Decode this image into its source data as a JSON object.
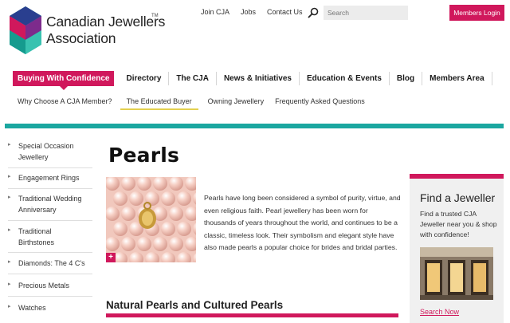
{
  "brand": {
    "line1": "Canadian Jewellers",
    "line2": "Association",
    "tm": "TM"
  },
  "utility": {
    "links": [
      "Join CJA",
      "Jobs",
      "Contact Us"
    ],
    "search_placeholder": "Search",
    "members_login": "Members Login"
  },
  "mainnav": {
    "items": [
      "Buying With Confidence",
      "Directory",
      "The CJA",
      "News & Initiatives",
      "Education & Events",
      "Blog",
      "Members Area"
    ],
    "active_index": 0
  },
  "subnav": {
    "items": [
      "Why Choose A CJA Member?",
      "The Educated Buyer",
      "Owning Jewellery",
      "Frequently Asked Questions"
    ],
    "active_index": 1
  },
  "sidebar": {
    "items": [
      {
        "line1": "Special Occasion",
        "line2": "Jewellery"
      },
      {
        "line1": "Engagement Rings",
        "line2": ""
      },
      {
        "line1": "Traditional Wedding",
        "line2": "Anniversary"
      },
      {
        "line1": "Traditional",
        "line2": "Birthstones"
      },
      {
        "line1": "Diamonds: The 4 C's",
        "line2": ""
      },
      {
        "line1": "Precious Metals",
        "line2": ""
      },
      {
        "line1": "Watches",
        "line2": ""
      }
    ]
  },
  "main": {
    "title": "Pearls",
    "intro": "Pearls have long been considered a symbol of purity, virtue, and even religious faith. Pearl jewellery has been worn for thousands of years throughout the world, and continues to be a classic, timeless look. Their symbolism  and elegant style have also made pearls a popular choice for brides and bridal parties.",
    "image_badge": "+",
    "section_heading": "Natural Pearls and Cultured Pearls"
  },
  "find_box": {
    "title": "Find a Jeweller",
    "text": "Find a trusted CJA Jeweller near you & shop with confidence!",
    "link": "Search Now"
  },
  "colors": {
    "brand_pink": "#d0185c",
    "teal": "#1ba7a0",
    "underline_yellow": "#e3d04f"
  },
  "icons": {
    "search": "search-icon",
    "logo": "cja-logo-icon",
    "arrow": "chevron-right-icon"
  }
}
